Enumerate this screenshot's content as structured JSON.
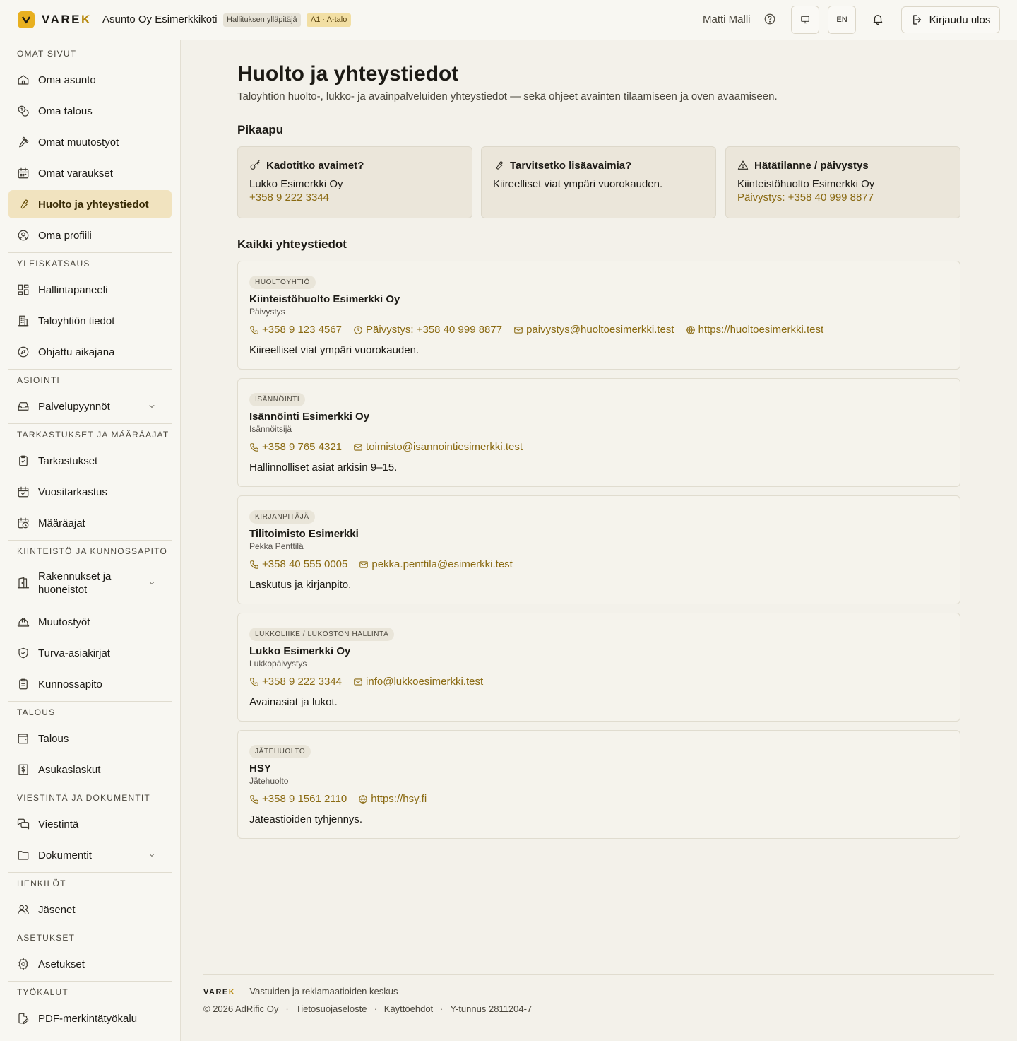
{
  "header": {
    "logo_text": "VARE",
    "logo_accent": "K",
    "org_name": "Asunto Oy Esimerkkikoti",
    "role_badge": "Hallituksen ylläpitäjä",
    "unit_badge": "A1 · A-talo",
    "user_name": "Matti Malli",
    "lang_label": "EN",
    "logout_label": "Kirjaudu ulos"
  },
  "sidebar": {
    "sections": [
      {
        "title": "OMAT SIVUT",
        "items": [
          "Oma asunto",
          "Oma talous",
          "Omat muutostyöt",
          "Omat varaukset",
          "Huolto ja yhteystiedot",
          "Oma profiili"
        ]
      },
      {
        "title": "YLEISKATSAUS",
        "items": [
          "Hallintapaneeli",
          "Taloyhtiön tiedot",
          "Ohjattu aikajana"
        ]
      },
      {
        "title": "ASIOINTI",
        "items": [
          "Palvelupyynnöt"
        ]
      },
      {
        "title": "TARKASTUKSET JA MÄÄRÄAJAT",
        "items": [
          "Tarkastukset",
          "Vuositarkastus",
          "Määräajat"
        ]
      },
      {
        "title": "KIINTEISTÖ JA KUNNOSSAPITO",
        "items": [
          "Rakennukset ja huoneistot",
          "Muutostyöt",
          "Turva-asiakirjat",
          "Kunnossapito"
        ]
      },
      {
        "title": "TALOUS",
        "items": [
          "Talous",
          "Asukaslaskut"
        ]
      },
      {
        "title": "VIESTINTÄ JA DOKUMENTIT",
        "items": [
          "Viestintä",
          "Dokumentit"
        ]
      },
      {
        "title": "HENKILÖT",
        "items": [
          "Jäsenet"
        ]
      },
      {
        "title": "ASETUKSET",
        "items": [
          "Asetukset"
        ]
      },
      {
        "title": "TYÖKALUT",
        "items": [
          "PDF-merkintätyökalu"
        ]
      }
    ],
    "active_item": "Huolto ja yhteystiedot"
  },
  "main": {
    "title": "Huolto ja yhteystiedot",
    "subtitle": "Taloyhtiön huolto-, lukko- ja avainpalveluiden yhteystiedot — sekä ohjeet avainten tilaamiseen ja oven avaamiseen.",
    "quick_heading": "Pikaapu",
    "quick": [
      {
        "title": "Kadotitko avaimet?",
        "line1": "Lukko Esimerkki Oy",
        "line2": "+358 9 222 3344",
        "icon": "key-icon"
      },
      {
        "title": "Tarvitsetko lisäavaimia?",
        "line1": "Kiireelliset viat ympäri vuorokauden.",
        "line2": "",
        "icon": "wrench-icon"
      },
      {
        "title": "Hätätilanne / päivystys",
        "line1": "Kiinteistöhuolto Esimerkki Oy",
        "line2": "Päivystys: +358 40 999 8877",
        "icon": "warning-icon"
      }
    ],
    "contacts_heading": "Kaikki yhteystiedot",
    "contacts": [
      {
        "category": "HUOLTOYHTIÖ",
        "name": "Kiinteistöhuolto Esimerkki Oy",
        "role": "Päivystys",
        "phone": "+358 9 123 4567",
        "duty": "Päivystys: +358 40 999 8877",
        "email": "paivystys@huoltoesimerkki.test",
        "web": "https://huoltoesimerkki.test",
        "note": "Kiireelliset viat ympäri vuorokauden."
      },
      {
        "category": "ISÄNNÖINTI",
        "name": "Isännöinti Esimerkki Oy",
        "role": "Isännöitsijä",
        "phone": "+358 9 765 4321",
        "duty": "",
        "email": "toimisto@isannointiesimerkki.test",
        "web": "",
        "note": "Hallinnolliset asiat arkisin 9–15."
      },
      {
        "category": "KIRJANPITÄJÄ",
        "name": "Tilitoimisto Esimerkki",
        "role": "Pekka Penttilä",
        "phone": "+358 40 555 0005",
        "duty": "",
        "email": "pekka.penttila@esimerkki.test",
        "web": "",
        "note": "Laskutus ja kirjanpito."
      },
      {
        "category": "LUKKOLIIKE / LUKOSTON HALLINTA",
        "name": "Lukko Esimerkki Oy",
        "role": "Lukkopäivystys",
        "phone": "+358 9 222 3344",
        "duty": "",
        "email": "info@lukkoesimerkki.test",
        "web": "",
        "note": "Avainasiat ja lukot."
      },
      {
        "category": "JÄTEHUOLTO",
        "name": "HSY",
        "role": "Jätehuolto",
        "phone": "+358 9 1561 2110",
        "duty": "",
        "email": "",
        "web": "https://hsy.fi",
        "note": "Jäteastioiden tyhjennys."
      }
    ]
  },
  "footer": {
    "brand": "VARE",
    "brand_accent": "K",
    "tagline": " — Vastuiden ja reklamaatioiden keskus",
    "copyright": "© 2026 AdRific Oy",
    "privacy": "Tietosuojaseloste",
    "terms": "Käyttöehdot",
    "business_id": "Y-tunnus 2811204-7"
  },
  "colors": {
    "accent": "#e8b020",
    "link": "#8a6a12",
    "active_bg": "#f1e3bf"
  }
}
